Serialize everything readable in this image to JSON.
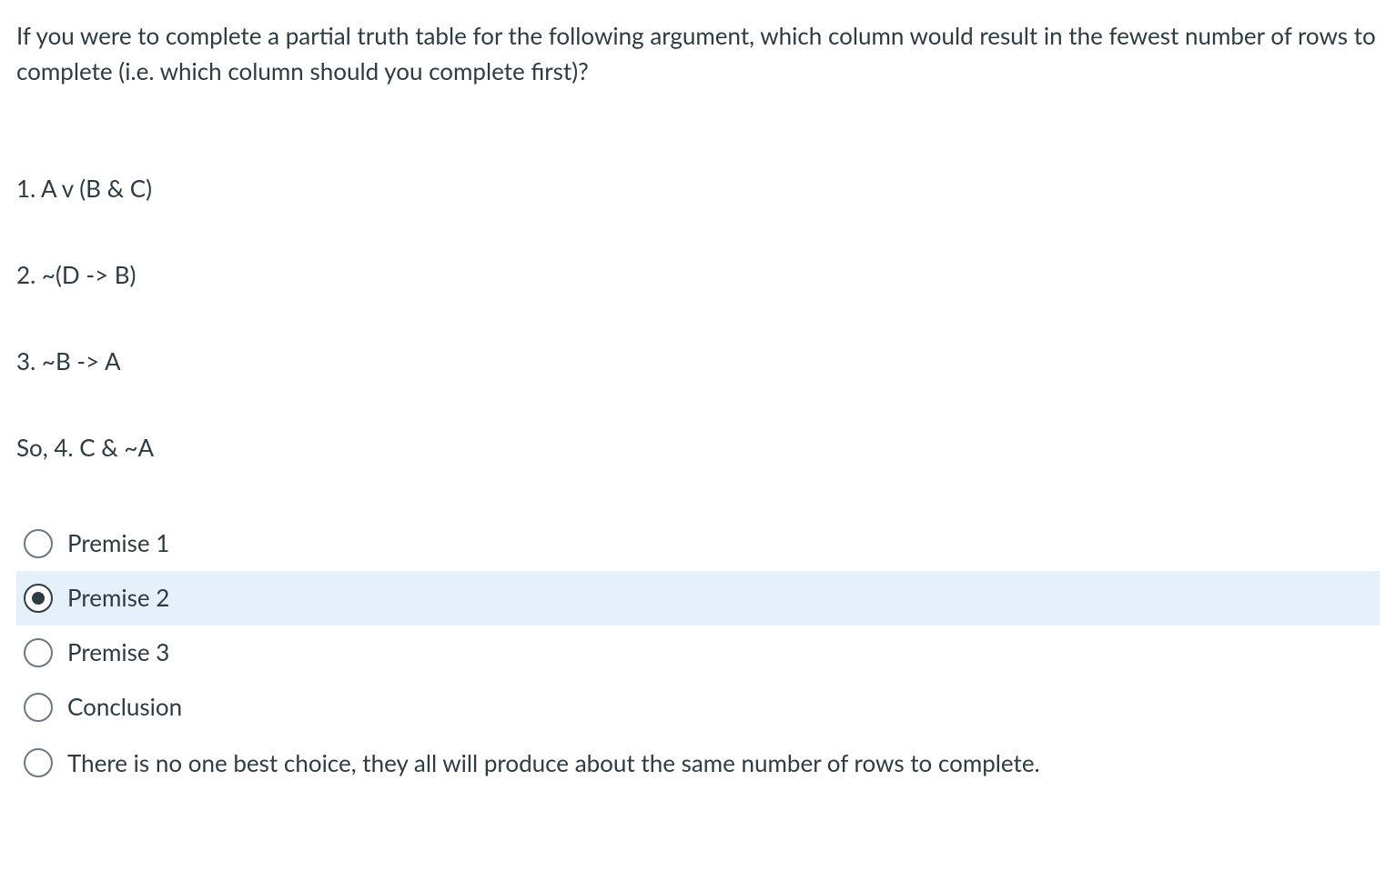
{
  "question": "If you were to complete a partial truth table for the following argument, which column would result in the fewest number of rows to complete (i.e. which column should you complete first)?",
  "premises": {
    "p1": "1. A v (B & C)",
    "p2": "2. ~(D -> B)",
    "p3": "3. ~B -> A",
    "conclusion": "So, 4. C & ~A"
  },
  "options": [
    {
      "label": "Premise 1",
      "selected": false
    },
    {
      "label": "Premise 2",
      "selected": true
    },
    {
      "label": "Premise 3",
      "selected": false
    },
    {
      "label": "Conclusion",
      "selected": false
    },
    {
      "label": "There is no one best choice, they all will produce about the same number of rows to complete.",
      "selected": false
    }
  ]
}
